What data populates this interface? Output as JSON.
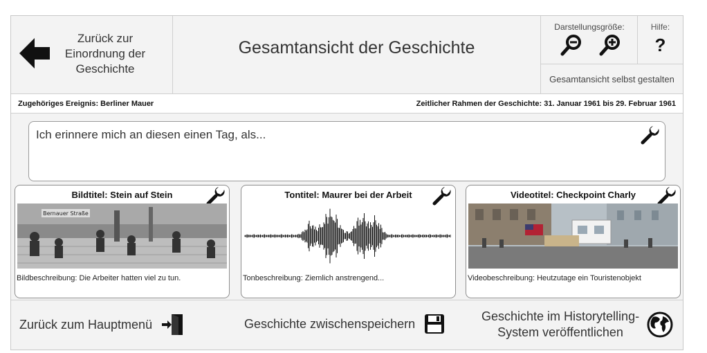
{
  "header": {
    "back_label": "Zurück zur\nEinordnung der\nGeschichte",
    "title": "Gesamtansicht der Geschichte",
    "size_label": "Darstellungsgröße:",
    "help_label": "Hilfe:",
    "help_symbol": "?",
    "customize_label": "Gesamtansicht selbst gestalten"
  },
  "infobar": {
    "event": "Zugehöriges Ereignis: Berliner Mauer",
    "timeframe": "Zeitlicher Rahmen der Geschichte: 31. Januar 1961 bis 29. Februar 1961"
  },
  "story": {
    "text": "Ich erinnere mich an diesen einen Tag, als..."
  },
  "cards": [
    {
      "title": "Bildtitel: Stein auf Stein",
      "description": "Bildbeschreibung: Die Arbeiter hatten viel zu tun.",
      "sign_text": "Bernauer Straße"
    },
    {
      "title": "Tontitel: Maurer bei der Arbeit",
      "description": "Tonbeschreibung: Ziemlich anstrengend..."
    },
    {
      "title": "Videotitel: Checkpoint Charly",
      "description": "Videobeschreibung: Heutzutage ein Touristenobjekt"
    }
  ],
  "footer": {
    "main_menu": "Zurück zum Hauptmenü",
    "save": "Geschichte zwischenspeichern",
    "publish": "Geschichte im Historytelling-\nSystem veröffentlichen"
  },
  "icons": {
    "back": "arrow-left-icon",
    "zoom_out": "zoom-out-icon",
    "zoom_in": "zoom-in-icon",
    "edit": "wrench-icon",
    "exit": "exit-door-icon",
    "save": "floppy-disk-icon",
    "publish": "globe-icon"
  },
  "colors": {
    "background": "#f3f3f3",
    "border": "#cfcfcf",
    "icon": "#111111"
  }
}
